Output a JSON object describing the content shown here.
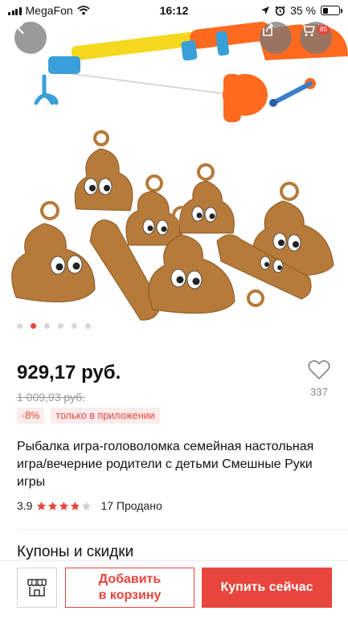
{
  "status_bar": {
    "carrier": "MegaFon",
    "time": "16:12",
    "battery_percent": "35 %",
    "battery_level": 0.35
  },
  "header": {
    "back_icon": "chevron-left-icon",
    "share_icon": "share-icon",
    "cart_icon": "cart-icon",
    "cart_count": "85"
  },
  "gallery": {
    "image_count": 6,
    "active_index": 1
  },
  "product": {
    "price": "929,17 руб.",
    "old_price": "1 009,93 руб.",
    "discount": "-8%",
    "app_only": "только в приложении",
    "wishlist_count": "337",
    "title": "Рыбалка игра-головоломка семейная настольная игра/вечерние родители с детьми Смешные Руки игры",
    "rating": "3.9",
    "rating_value": 3.9,
    "sold": "17 Продано"
  },
  "sections": {
    "coupons": "Купоны и скидки"
  },
  "bottom_bar": {
    "store_icon": "store-icon",
    "add_to_cart_line1": "Добавить",
    "add_to_cart_line2": "в корзину",
    "buy_now": "Купить сейчас"
  },
  "colors": {
    "accent": "#e8453c",
    "tag_bg": "#fdeceb"
  }
}
